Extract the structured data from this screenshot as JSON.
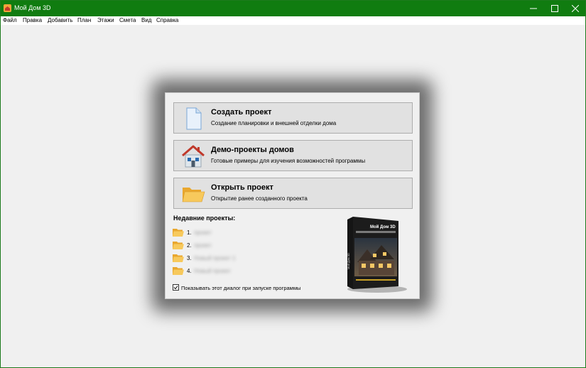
{
  "window": {
    "title": "Мой Дом 3D",
    "accent_color": "#107c10",
    "controls": {
      "minimize_icon": "minimize-icon",
      "maximize_icon": "maximize-icon",
      "close_icon": "close-icon"
    }
  },
  "menu": {
    "items": [
      "Файл",
      "Правка",
      "Добавить",
      "План",
      "Этажи",
      "Смета",
      "Вид",
      "Справка"
    ]
  },
  "dialog": {
    "actions": [
      {
        "title": "Создать проект",
        "subtitle": "Создание планировки и внешней отделки дома",
        "icon": "new-document-icon"
      },
      {
        "title": "Демо-проекты домов",
        "subtitle": "Готовые примеры для изучения возможностей программы",
        "icon": "house-icon"
      },
      {
        "title": "Открыть проект",
        "subtitle": "Открытие ранее созданного проекта",
        "icon": "open-folder-icon"
      }
    ],
    "recent_heading": "Недавние проекты:",
    "recent": [
      {
        "num": "1.",
        "name": "проект"
      },
      {
        "num": "2.",
        "name": "проект"
      },
      {
        "num": "3.",
        "name": "Новый проект 1"
      },
      {
        "num": "4.",
        "name": "Новый проект"
      }
    ],
    "show_on_startup": {
      "label": "Показывать этот диалог при запуске программы",
      "checked": true
    },
    "box_art": {
      "product_title": "Мой Дом 3D",
      "spine_text": "Мой Дом 3D"
    }
  }
}
